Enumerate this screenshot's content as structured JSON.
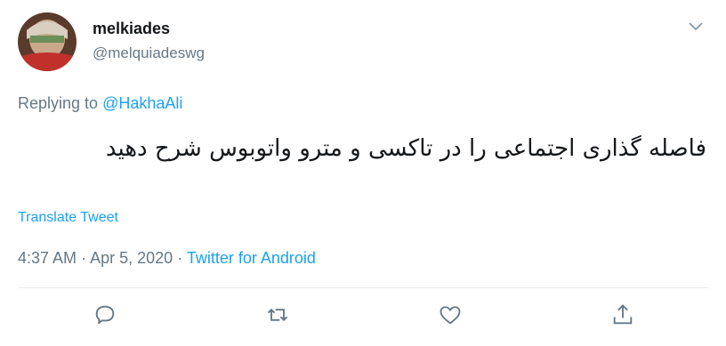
{
  "user": {
    "name": "melkiades",
    "handle": "@melquiadeswg"
  },
  "replying": {
    "prefix": "Replying to",
    "target": "@HakhaAli"
  },
  "tweet": {
    "text": "فاصله گذاری اجتماعی را در تاکسی و مترو واتوبوس شرح دهید",
    "translate_label": "Translate Tweet"
  },
  "meta": {
    "time": "4:37 AM",
    "separator1": "·",
    "date": "Apr 5, 2020",
    "separator2": "·",
    "source": "Twitter for Android"
  },
  "actions": {
    "icons": [
      "reply-icon",
      "retweet-icon",
      "like-icon",
      "share-icon"
    ]
  },
  "colors": {
    "accent": "#1da1f2",
    "secondary_text": "#657786",
    "primary_text": "#14171a",
    "divider": "#e6ecf0"
  }
}
